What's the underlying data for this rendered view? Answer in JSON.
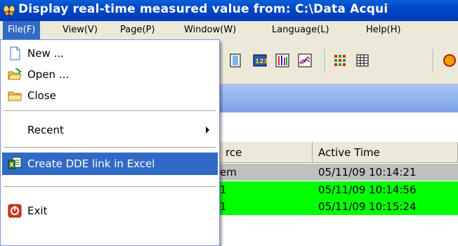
{
  "window": {
    "title": "Display real-time measured value from: C:\\Data Acqui",
    "icon": "butterfly-app-icon"
  },
  "menubar": {
    "items": [
      {
        "label": "File(F)",
        "active": true
      },
      {
        "label": "View(V)"
      },
      {
        "label": "Page(P)"
      },
      {
        "label": "Window(W)"
      },
      {
        "label": "Language(L)"
      },
      {
        "label": "Help(H)"
      }
    ]
  },
  "file_menu": {
    "new_label": "New ...",
    "open_label": "Open ...",
    "close_label": "Close",
    "recent_label": "Recent",
    "dde_label": "Create DDE link in Excel",
    "exit_label": "Exit"
  },
  "table": {
    "columns": [
      "rce",
      "Active Time"
    ],
    "rows": [
      {
        "source": "em",
        "time": "05/11/09 10:14:21",
        "color": "#c0c0c0"
      },
      {
        "source": "1",
        "time": "05/11/09 10:14:56",
        "color": "#00ff00"
      },
      {
        "source": "1",
        "time": "05/11/09 10:15:24",
        "color": "#00ff00"
      }
    ]
  },
  "colors": {
    "titlebar": "#0047c9",
    "highlight": "#316ac5",
    "alarm_green": "#00ff00",
    "inactive_gray": "#c0c0c0"
  }
}
